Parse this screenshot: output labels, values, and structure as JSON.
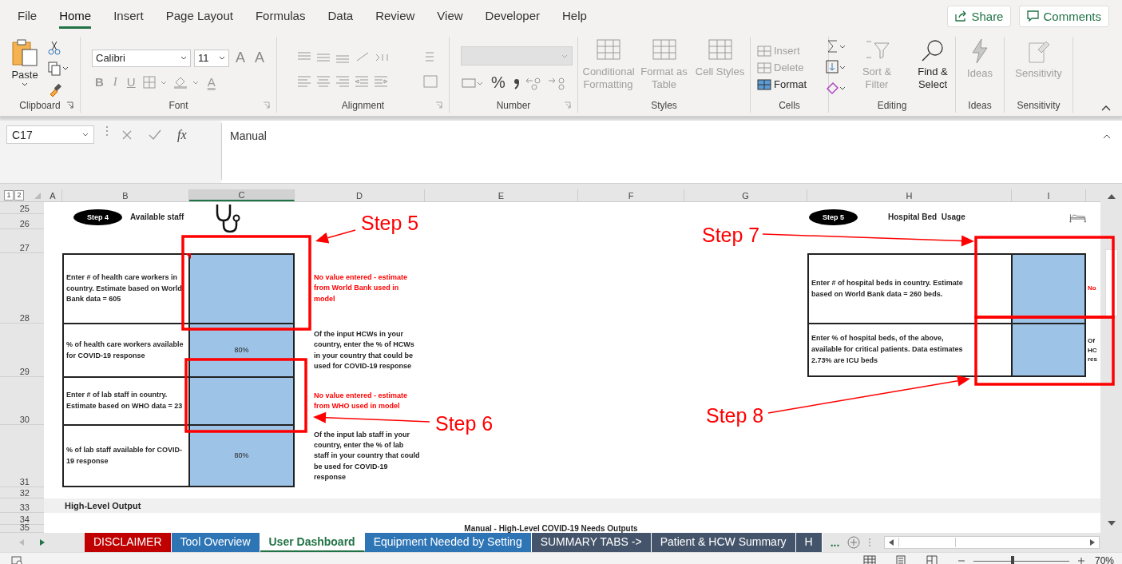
{
  "menu_tabs": [
    {
      "label": "File",
      "selected": false
    },
    {
      "label": "Home",
      "selected": true
    },
    {
      "label": "Insert",
      "selected": false
    },
    {
      "label": "Page Layout",
      "selected": false
    },
    {
      "label": "Formulas",
      "selected": false
    },
    {
      "label": "Data",
      "selected": false
    },
    {
      "label": "Review",
      "selected": false
    },
    {
      "label": "View",
      "selected": false
    },
    {
      "label": "Developer",
      "selected": false
    },
    {
      "label": "Help",
      "selected": false
    }
  ],
  "share_button": "Share",
  "comments_button": "Comments",
  "ribbon": {
    "clipboard": {
      "label": "Clipboard",
      "paste": "Paste"
    },
    "font": {
      "label": "Font",
      "name": "Calibri",
      "size": "11",
      "size_buttons": [
        "A",
        "A"
      ],
      "style_buttons": [
        "B",
        "I",
        "U"
      ],
      "color_button": "A"
    },
    "alignment": {
      "label": "Alignment"
    },
    "number": {
      "label": "Number",
      "percent": "%"
    },
    "styles": {
      "label": "Styles",
      "buttons": [
        {
          "label": "Conditional Formatting",
          "disabled": true
        },
        {
          "label": "Format as Table",
          "disabled": true
        },
        {
          "label": "Cell Styles",
          "disabled": true
        }
      ]
    },
    "cells": {
      "label": "Cells",
      "buttons": [
        {
          "label": "Insert",
          "disabled": true
        },
        {
          "label": "Delete",
          "disabled": true
        },
        {
          "label": "Format",
          "disabled": false
        }
      ]
    },
    "editing": {
      "label": "Editing",
      "buttons": [
        {
          "label": "Sort & Filter",
          "disabled": true
        },
        {
          "label": "Find & Select",
          "disabled": false
        }
      ]
    },
    "ideas": {
      "label": "Ideas",
      "button": {
        "label": "Ideas",
        "disabled": true
      }
    },
    "sensitivity": {
      "label": "Sensitivity",
      "button": {
        "label": "Sensitivity",
        "disabled": true
      }
    }
  },
  "formula_bar": {
    "name_box": "C17",
    "fx": "fx",
    "formula": "Manual"
  },
  "outline_levels": [
    "1",
    "2"
  ],
  "columns": [
    {
      "label": "A",
      "selected": false
    },
    {
      "label": "B",
      "selected": false
    },
    {
      "label": "C",
      "selected": true
    },
    {
      "label": "D",
      "selected": false
    },
    {
      "label": "E",
      "selected": false
    },
    {
      "label": "F",
      "selected": false
    },
    {
      "label": "G",
      "selected": false
    },
    {
      "label": "H",
      "selected": false
    },
    {
      "label": "I",
      "selected": false
    }
  ],
  "row_numbers": [
    "25",
    "26",
    "27",
    "28",
    "29",
    "30",
    "31",
    "32",
    "33",
    "34",
    "35"
  ],
  "staff_section": {
    "step": "Step 4",
    "title": "Available staff",
    "rows": [
      {
        "label": "Enter # of health care workers in country. Estimate based on World Bank data = 605",
        "note": "No value entered - estimate from World Bank used in model",
        "kind": "warning"
      },
      {
        "label": "% of health care workers available for COVID-19 response",
        "value": "80%",
        "note": "Of the input HCWs in your country, enter the % of HCWs in your country that could be used for COVID-19 response",
        "kind": "info"
      },
      {
        "label": "Enter # of lab staff in country. Estimate based on WHO data = 23",
        "note": "No value entered - estimate from WHO used in model",
        "kind": "warning"
      },
      {
        "label": "% of lab staff available for COVID-19 response",
        "value": "80%",
        "note": "Of the input lab staff in your country, enter the % of lab staff in your country that could be used for COVID-19 response",
        "kind": "info"
      }
    ]
  },
  "beds_section": {
    "step": "Step 5",
    "title": "Hospital Bed  Usage",
    "rows": [
      {
        "label": "Enter # of hospital beds in country. Estimate based on World Bank data = 260 beds.",
        "note": "No",
        "kind": "warning"
      },
      {
        "label": "Enter % of hospital beds, of the above, available for critical patients. Data estimates 2.73% are ICU beds",
        "note": "Of HC res",
        "kind": "info"
      }
    ]
  },
  "high_level_output": "High-Level Output",
  "outputs_title": "Manual - High-Level COVID-19 Needs Outputs",
  "annotations": [
    {
      "label": "Step 5"
    },
    {
      "label": "Step 6"
    },
    {
      "label": "Step 7"
    },
    {
      "label": "Step 8"
    }
  ],
  "sheet_tabs": [
    {
      "label": "DISCLAIMER",
      "color": "#c00000",
      "selected": false
    },
    {
      "label": "Tool Overview",
      "color": "#2e75b6",
      "selected": false
    },
    {
      "label": "User Dashboard",
      "color": "#217346",
      "selected": true
    },
    {
      "label": "Equipment Needed by Setting",
      "color": "#2e75b6",
      "selected": false
    },
    {
      "label": "SUMMARY TABS ->",
      "color": "#44546a",
      "selected": false
    },
    {
      "label": "Patient & HCW Summary",
      "color": "#44546a",
      "selected": false
    },
    {
      "label": "H",
      "color": "#44546a",
      "selected": false
    }
  ],
  "more_tabs": "...",
  "zoom": {
    "level": 0.41,
    "reading": "70%"
  }
}
